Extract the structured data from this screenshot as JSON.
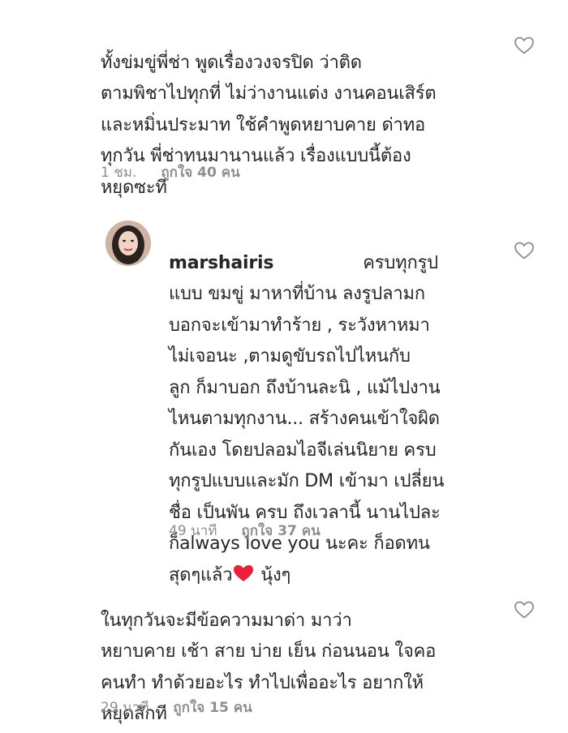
{
  "comments": [
    {
      "text": "ทั้งข่มขู่พี่ช่า พูดเรื่องวงจรปิด ว่าติด\nตามพิชาไปทุกที่ ไม่ว่างานแต่ง งานคอนเสิร์ต\nและหมิ่นประมาท ใช้คำพูดหยาบคาย ด่าทอ\nทุกวัน พี่ช่าทนมานานแล้ว เรื่องแบบนี้ต้อง\nหยุดซะที",
      "time": "1 ชม.",
      "likes": "ถูกใจ 40 คน"
    },
    {
      "username": "marshairis",
      "text_first": "ครบทุกรูป",
      "text": "แบบ ขมขู่ มาหาที่บ้าน ลงรูปลามก\nบอกจะเข้ามาทำร้าย , ระวังหาหมา\nไม่เจอนะ ,ตามดูขับรถไปไหนกับ\nลูก ก็มาบอก ถึงบ้านละนิ , แม้ไปงาน\nไหนตามทุกงาน... สร้างคนเข้าใจผิด\nกันเอง โดยปลอมไอจีเล่นนิยาย ครบ\nทุกรูปแบบและมัก DM เข้ามา เปลี่ยน\nชื่อ เป็นพัน ครบ ถึงเวลานี้ นานไปละ\nก็always love you นะคะ  ก็อดทน",
      "last_line_a": "สุดๆแล้ว",
      "last_line_b": " นุ้งๆ",
      "time": "49 นาที",
      "likes": "ถูกใจ 37 คน"
    },
    {
      "text": "ในทุกวันจะมีข้อความมาด่า มาว่า\nหยาบคาย เช้า สาย บ่าย เย็น ก่อนนอน ใจคอ\nคนทำ ทำด้วยอะไร ทำไปเพื่ออะไร อยากให้\nหยุดสักที",
      "time": "29 นาที",
      "likes": "ถูกใจ 15 คน"
    }
  ],
  "icons": {
    "like": "heart-outline-icon",
    "emoji": "red-heart-emoji"
  },
  "colors": {
    "text": "#262626",
    "meta": "#8e8e8e",
    "heart_emoji": "#e8203a"
  }
}
